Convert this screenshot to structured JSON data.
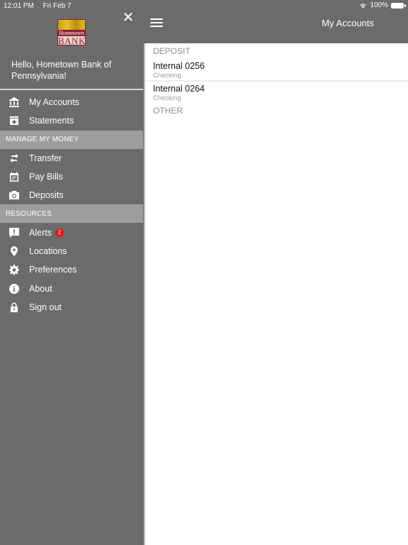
{
  "status_bar": {
    "time": "12:01 PM",
    "date": "Fri Feb 7",
    "battery": "100%"
  },
  "drawer": {
    "logo": {
      "line1": "Hometown",
      "line2": "BANK"
    },
    "greeting": "Hello, Hometown Bank of Pennsylvania!",
    "items_top": [
      {
        "label": "My Accounts",
        "icon": "bank-icon"
      },
      {
        "label": "Statements",
        "icon": "archive-icon"
      }
    ],
    "section_manage": "MANAGE MY MONEY",
    "items_manage": [
      {
        "label": "Transfer",
        "icon": "transfer-icon"
      },
      {
        "label": "Pay Bills",
        "icon": "calendar-icon"
      },
      {
        "label": "Deposits",
        "icon": "camera-icon"
      }
    ],
    "section_resources": "RESOURCES",
    "items_resources": [
      {
        "label": "Alerts",
        "icon": "alert-icon",
        "badge": "2"
      },
      {
        "label": "Locations",
        "icon": "location-pin-icon"
      },
      {
        "label": "Preferences",
        "icon": "gear-icon"
      },
      {
        "label": "About",
        "icon": "info-icon"
      },
      {
        "label": "Sign out",
        "icon": "lock-icon"
      }
    ]
  },
  "navbar": {
    "title": "My Accounts"
  },
  "accounts": {
    "deposit_header": "DEPOSIT",
    "deposit": [
      {
        "name": "Internal 0256",
        "type": "Checking"
      },
      {
        "name": "Internal 0264",
        "type": "Checking"
      }
    ],
    "other_header": "OTHER"
  },
  "colors": {
    "chrome": "#6b6b6b",
    "section": "#9d9d9d",
    "badge": "#f0121c",
    "logo": "#8a1f3a"
  }
}
